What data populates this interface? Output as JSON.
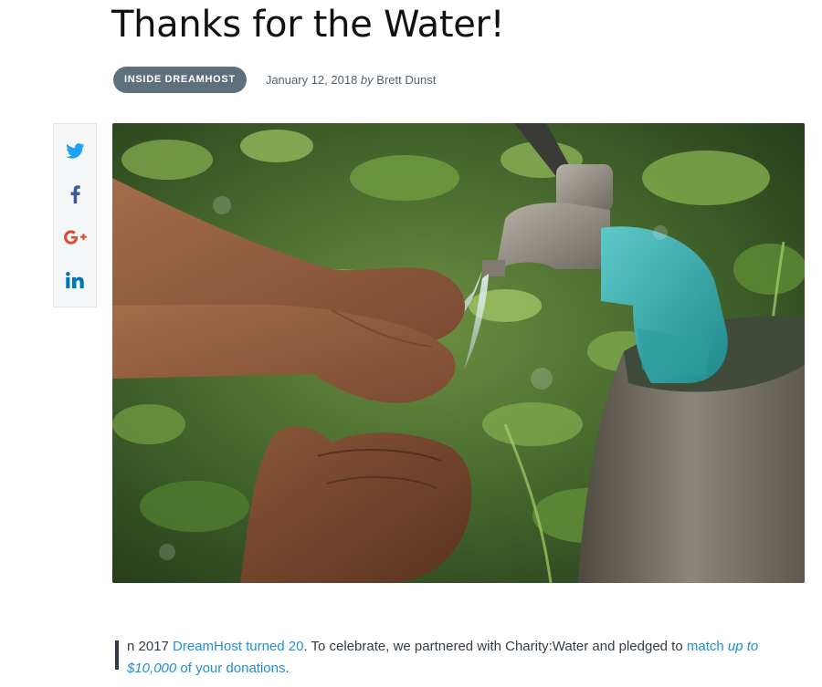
{
  "article": {
    "title": "Thanks for the Water!",
    "category": "INSIDE DREAMHOST",
    "date": "January 12, 2018",
    "by_word": "by",
    "author": "Brett Dunst"
  },
  "share": {
    "items": [
      {
        "network": "twitter",
        "icon": "twitter-icon",
        "color": "#1da1f2"
      },
      {
        "network": "facebook",
        "icon": "facebook-icon",
        "color": "#3b5998"
      },
      {
        "network": "google-plus",
        "icon": "google-plus-icon",
        "color": "#dd4b39"
      },
      {
        "network": "linkedin",
        "icon": "linkedin-icon",
        "color": "#0077b5"
      }
    ]
  },
  "hero": {
    "subject": "hands catching water from an outdoor tap"
  },
  "intro": {
    "text_1": "n 2017 ",
    "link_1": "DreamHost turned 20",
    "text_2": ". To celebrate, we partnered with Charity:Water and pledged to ",
    "link_2_a": "match ",
    "link_2_b": "up to $10,000",
    "link_2_c": " of your donations",
    "text_3": "."
  },
  "colors": {
    "link": "#1f8fd6",
    "category_bg": "#5f707d",
    "body_text": "#333c44"
  }
}
